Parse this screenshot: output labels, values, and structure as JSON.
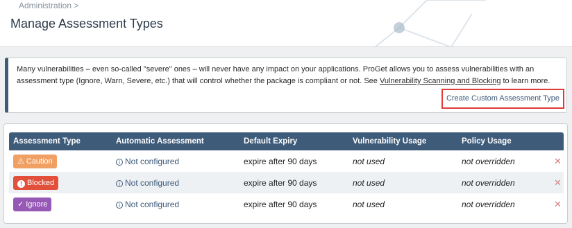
{
  "breadcrumb": "Administration >",
  "page_title": "Manage Assessment Types",
  "info": {
    "text_before_link": "Many vulnerabilities – even so-called \"severe\" ones – will never have any impact on your applications. ProGet allows you to assess vulnerabilities with an assessment type (Ignore, Warn, Severe, etc.) that will control whether the package is compliant or not. See ",
    "link_label": "Vulnerability Scanning and Blocking",
    "text_after_link": " to learn more.",
    "create_button_label": "Create Custom Assessment Type"
  },
  "table": {
    "headers": [
      "Assessment Type",
      "Automatic Assessment",
      "Default Expiry",
      "Vulnerability Usage",
      "Policy Usage",
      ""
    ],
    "rows": [
      {
        "type": "Caution",
        "type_color": "#f0a063",
        "type_icon": "warning-icon",
        "auto": "Not configured",
        "expiry": "expire after 90 days",
        "vuln_usage": "not used",
        "policy_usage": "not overridden"
      },
      {
        "type": "Blocked",
        "type_color": "#e2503c",
        "type_icon": "blocked-icon",
        "auto": "Not configured",
        "expiry": "expire after 90 days",
        "vuln_usage": "not used",
        "policy_usage": "not overridden"
      },
      {
        "type": "Ignore",
        "type_color": "#9659b6",
        "type_icon": "check-icon",
        "auto": "Not configured",
        "expiry": "expire after 90 days",
        "vuln_usage": "not used",
        "policy_usage": "not overridden"
      }
    ]
  },
  "colors": {
    "header_accent": "#3e5b7a",
    "highlight_border": "#e03b3b"
  }
}
